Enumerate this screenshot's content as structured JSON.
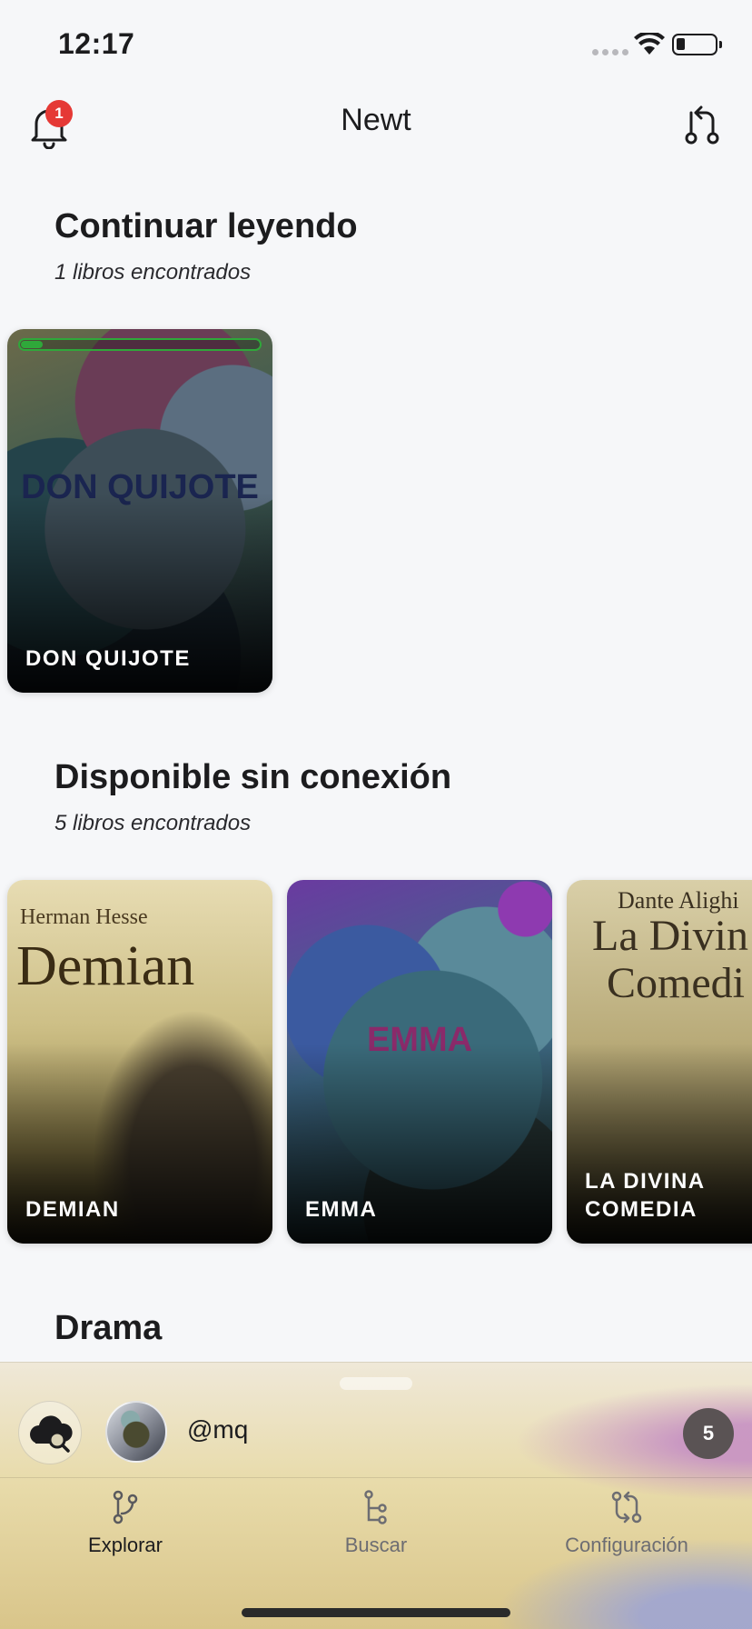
{
  "status_bar": {
    "time": "12:17"
  },
  "header": {
    "title": "Newt",
    "notification_count": "1",
    "bell_icon": "bell-icon",
    "action_icon": "git-compare-icon"
  },
  "continue_reading": {
    "title": "Continuar leyendo",
    "subtitle": "1 libros encontrados",
    "books": [
      {
        "title": "DON QUIJOTE",
        "cover_text": "DON QUIJOTE",
        "progress": 0.09
      }
    ]
  },
  "offline": {
    "title": "Disponible sin conexión",
    "subtitle": "5 libros encontrados",
    "books": [
      {
        "title": "DEMIAN",
        "cover_author": "Herman Hesse",
        "cover_title": "Demian"
      },
      {
        "title": "EMMA",
        "cover_text": "EMMA"
      },
      {
        "title": "LA DIVINA COMEDIA",
        "cover_author": "Dante Alighi",
        "cover_title_line1": "La Divin",
        "cover_title_line2": "Comedi"
      }
    ]
  },
  "drama": {
    "title": "Drama"
  },
  "bottom_panel": {
    "username": "@mq",
    "count": "5",
    "cloud_icon": "cloud-search-icon"
  },
  "tabs": [
    {
      "label": "Explorar",
      "icon": "git-fork-icon",
      "active": true
    },
    {
      "label": "Buscar",
      "icon": "git-tree-icon",
      "active": false
    },
    {
      "label": "Configuración",
      "icon": "git-compare-icon",
      "active": false
    }
  ],
  "colors": {
    "background": "#f6f7f9",
    "badge": "#e53935",
    "progress": "#2fa83a",
    "count_badge": "#5a5354"
  }
}
